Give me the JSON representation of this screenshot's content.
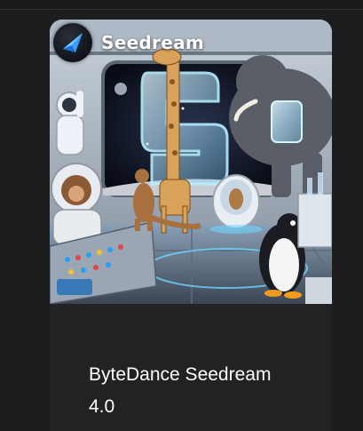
{
  "card": {
    "brand_name": "Seedream",
    "title": "ByteDance Seedream 4.0"
  },
  "icons": {
    "logo": "seedream-logo-icon"
  },
  "colors": {
    "page_background": "#1d1d1f",
    "card_background": "#222224",
    "title_text": "#ffffff"
  }
}
